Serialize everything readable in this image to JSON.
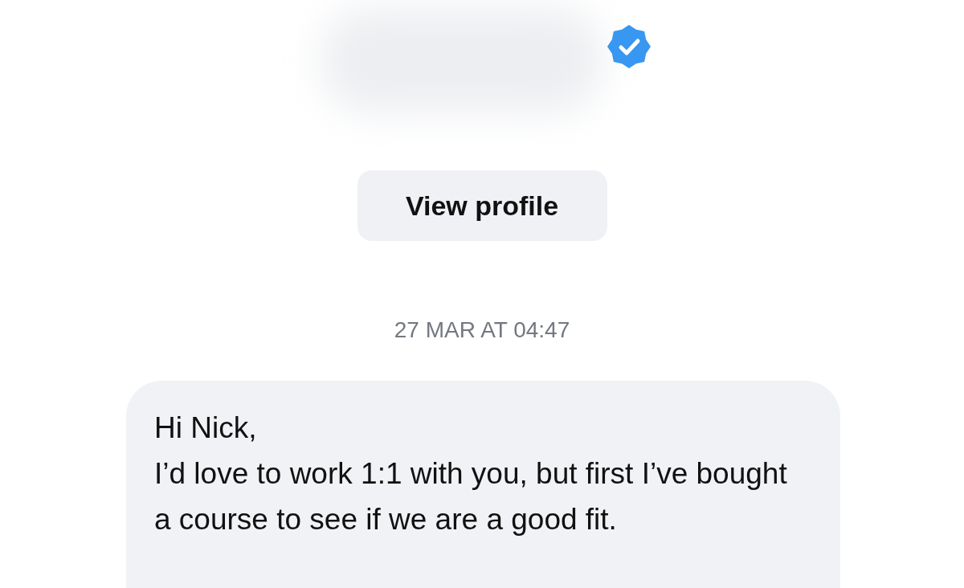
{
  "header": {
    "verified": true
  },
  "view_profile_button": "View profile",
  "timestamp": "27 MAR AT 04:47",
  "message": {
    "paragraphs": [
      "Hi Nick,",
      "I’d love to work 1:1 with you, but first I’ve bought a course to see if we are a good fit."
    ]
  }
}
